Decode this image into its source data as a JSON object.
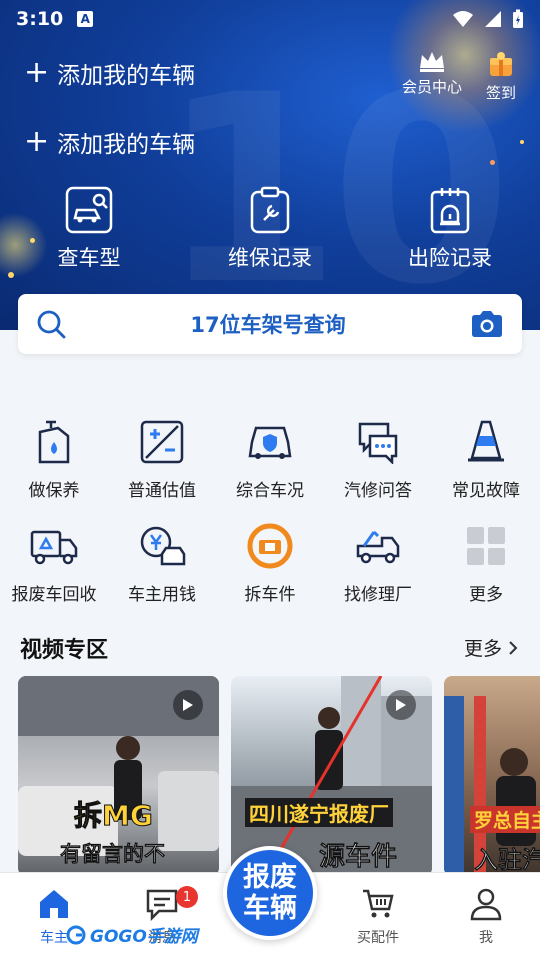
{
  "status_bar": {
    "time": "3:10",
    "notification_icon": "A"
  },
  "vehicles": {
    "add_1": "添加我的车辆",
    "add_2": "添加我的车辆"
  },
  "header_links": {
    "member": "会员中心",
    "signin": "签到"
  },
  "quick_actions": [
    {
      "label": "查车型",
      "icon": "car-search-icon"
    },
    {
      "label": "维保记录",
      "icon": "wrench-clipboard-icon"
    },
    {
      "label": "出险记录",
      "icon": "alarm-clipboard-icon"
    }
  ],
  "search": {
    "text": "17位车架号查询"
  },
  "services": [
    {
      "label": "做保养",
      "icon": "oil-can-icon"
    },
    {
      "label": "普通估值",
      "icon": "plus-minus-icon"
    },
    {
      "label": "综合车况",
      "icon": "car-shield-icon"
    },
    {
      "label": "汽修问答",
      "icon": "chat-bubbles-icon"
    },
    {
      "label": "常见故障",
      "icon": "traffic-cone-icon"
    },
    {
      "label": "报废车回收",
      "icon": "recycle-truck-icon"
    },
    {
      "label": "车主用钱",
      "icon": "yen-car-icon"
    },
    {
      "label": "拆车件",
      "icon": "parts-brand-icon"
    },
    {
      "label": "找修理厂",
      "icon": "tow-truck-icon"
    },
    {
      "label": "更多",
      "icon": "grid-icon"
    }
  ],
  "video_section": {
    "title": "视频专区",
    "more": "更多",
    "videos": [
      {
        "caption_1": "拆MG",
        "caption_2": "有留言的不"
      },
      {
        "caption_1": "四川遂宁报废厂",
        "caption_2": "源车件"
      },
      {
        "caption_1": "罗总自主",
        "caption_2": "入驻汽"
      }
    ]
  },
  "tabbar": {
    "tabs": [
      {
        "label": "车主"
      },
      {
        "label": "消息"
      },
      {
        "label": "买配件"
      },
      {
        "label": "我"
      }
    ],
    "center_1": "报废",
    "center_2": "车辆",
    "badge": "1"
  },
  "watermark": {
    "text": "GOGO手游网"
  },
  "colors": {
    "brand": "#1e66e0",
    "hero": "#103e9a",
    "accent_orange": "#f08a1e",
    "badge": "#e8352e"
  }
}
